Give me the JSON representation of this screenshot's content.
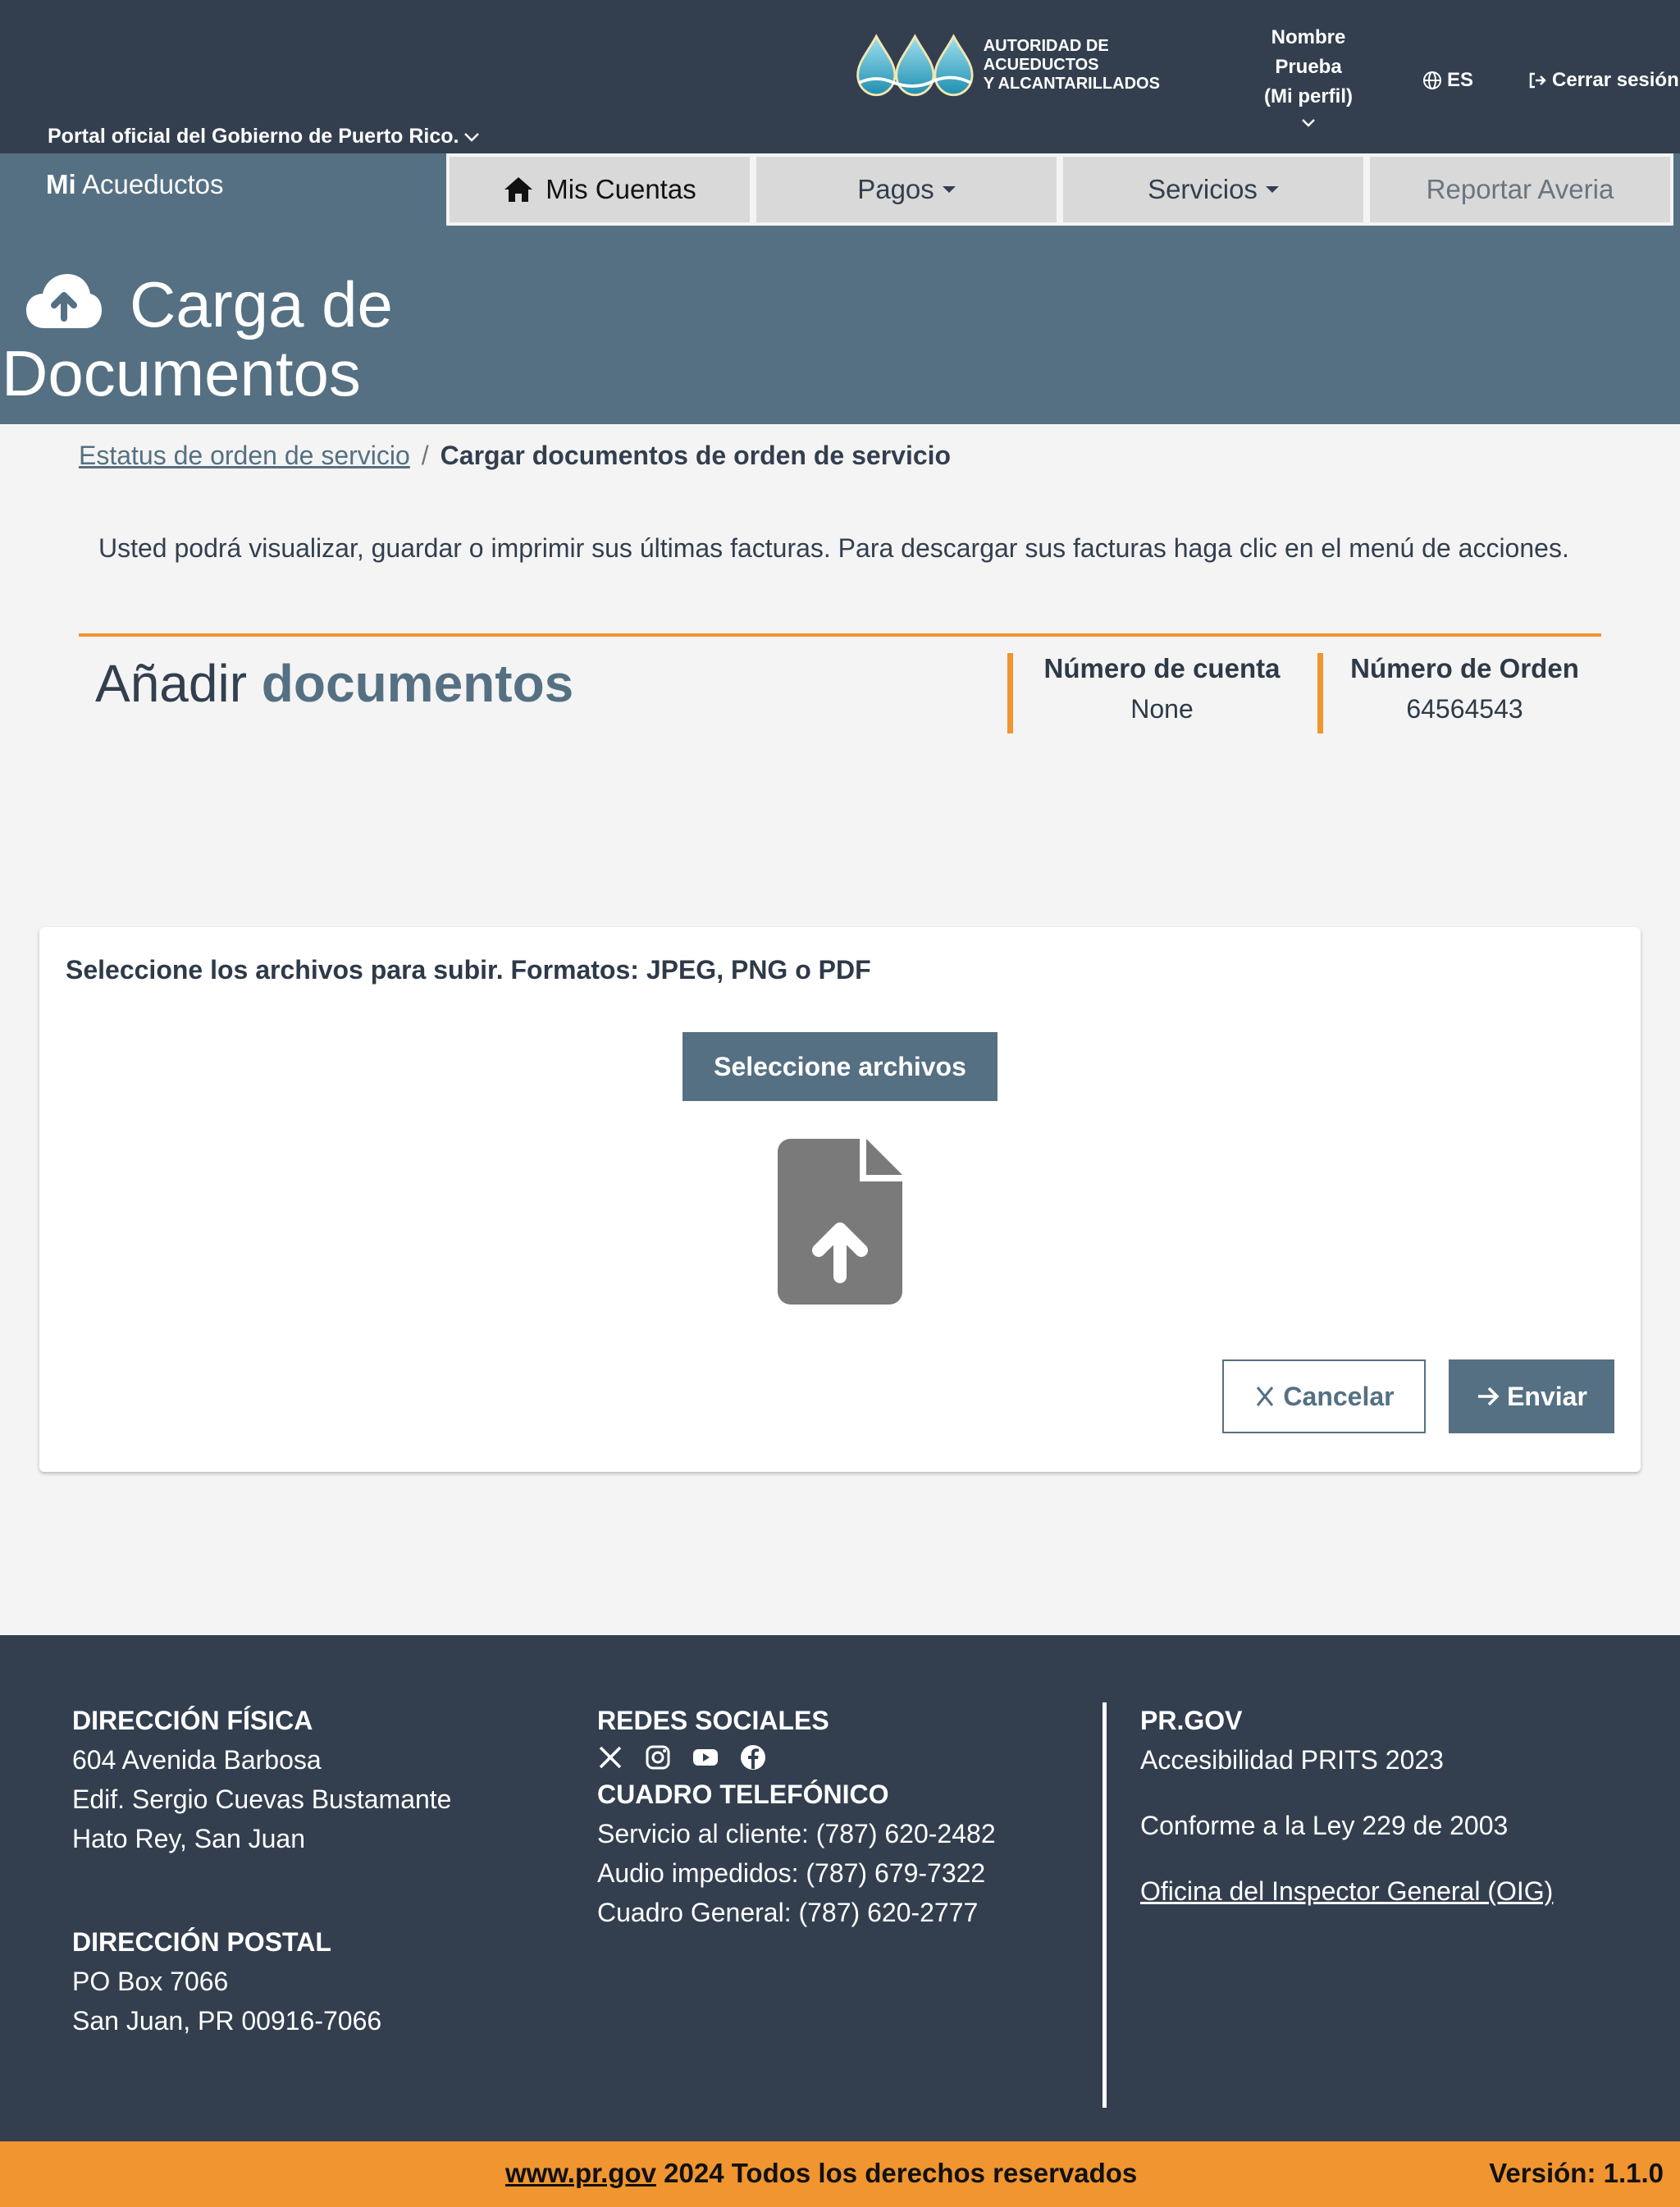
{
  "header": {
    "logo_text_line1": "AUTORIDAD DE ACUEDUCTOS",
    "logo_text_line2": "Y ALCANTARILLADOS",
    "profile_line1": "Nombre",
    "profile_line2": "Prueba",
    "profile_line3": "(Mi perfil)",
    "language": "ES",
    "logout": "Cerrar sesión",
    "portal": "Portal oficial del Gobierno de Puerto Rico."
  },
  "brand": {
    "bold": "Mi",
    "text": "Acueductos"
  },
  "nav": {
    "items": [
      {
        "label": "Mis Cuentas"
      },
      {
        "label": "Pagos"
      },
      {
        "label": "Servicios"
      },
      {
        "label": "Reportar Averia"
      }
    ]
  },
  "page": {
    "title_line1": "Carga de",
    "title_line2": "Documentos"
  },
  "breadcrumb": {
    "link": "Estatus de orden de servicio",
    "separator": "/",
    "current": "Cargar documentos de orden de servicio"
  },
  "intro": "Usted podrá visualizar, guardar o imprimir sus últimas facturas. Para descargar sus facturas haga clic en el menú de acciones.",
  "section": {
    "title_normal": "Añadir",
    "title_bold": "documentos",
    "account_label": "Número de cuenta",
    "account_value": "None",
    "order_label": "Número de Orden",
    "order_value": "64564543"
  },
  "upload": {
    "label": "Seleccione los archivos para subir. Formatos: JPEG, PNG o PDF",
    "select_button": "Seleccione archivos",
    "cancel_button": "Cancelar",
    "send_button": "Enviar"
  },
  "footer": {
    "physical_title": "DIRECCIÓN FÍSICA",
    "physical_lines": [
      "604 Avenida Barbosa",
      "Edif. Sergio Cuevas Bustamante",
      "Hato Rey, San Juan"
    ],
    "postal_title": "DIRECCIÓN POSTAL",
    "postal_lines": [
      "PO Box 7066",
      "San Juan, PR 00916-7066"
    ],
    "social_title": "REDES SOCIALES",
    "phone_title": "CUADRO TELEFÓNICO",
    "phone_lines": [
      "Servicio al cliente: (787) 620-2482",
      "Audio impedidos: (787) 679-7322",
      "Cuadro General: (787) 620-2777"
    ],
    "prgov_title": "PR.GOV",
    "prgov_lines": [
      "Accesibilidad PRITS 2023",
      "Conforme a la Ley 229 de 2003"
    ],
    "oig_link": "Oficina del Inspector General (OIG)"
  },
  "bottom": {
    "site": "www.pr.gov",
    "copyright": " 2024 Todos los derechos reservados",
    "version": "Versión: 1.1.0"
  },
  "colors": {
    "header_bg": "#333f4f",
    "hero_bg": "#557082",
    "accent_orange": "#f0952f",
    "primary_button": "#557082"
  },
  "icons": [
    "water-drops-logo-icon",
    "chevron-down-icon",
    "globe-icon",
    "logout-icon",
    "home-icon",
    "cloud-upload-icon",
    "file-upload-icon",
    "close-icon",
    "arrow-right-icon",
    "x-twitter-icon",
    "instagram-icon",
    "youtube-icon",
    "facebook-icon"
  ]
}
